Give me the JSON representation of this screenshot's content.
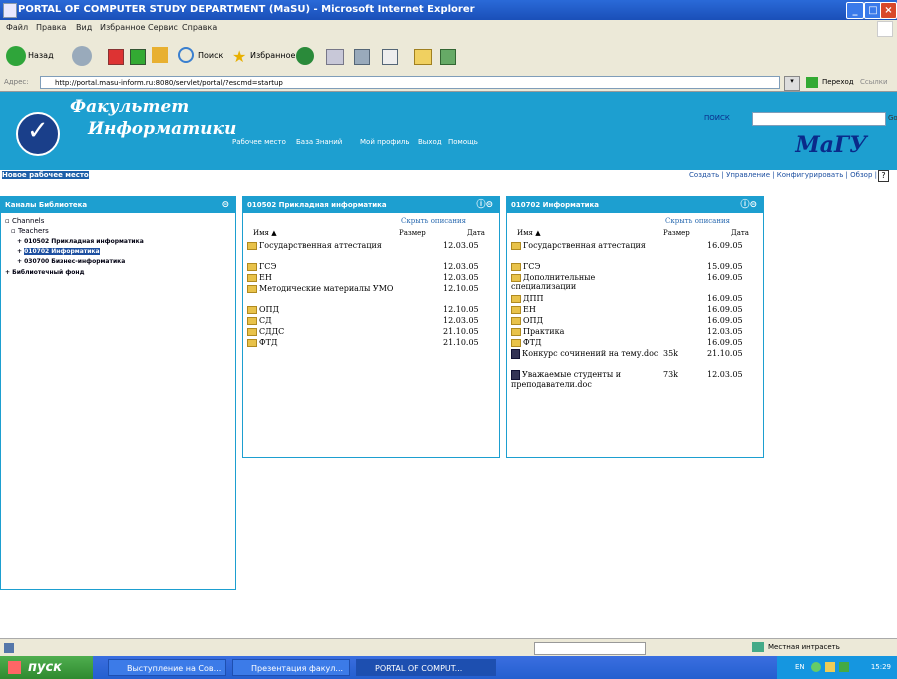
{
  "window": {
    "title": "PORTAL OF COMPUTER STUDY DEPARTMENT (MaSU) - Microsoft Internet Explorer"
  },
  "menu": [
    "Файл",
    "Правка",
    "Вид",
    "Избранное",
    "Сервис",
    "Справка"
  ],
  "toolbar": {
    "back": "Назад",
    "search": "Поиск",
    "favorites": "Избранное"
  },
  "address": {
    "label": "Адрес:",
    "url": "http://portal.masu-inform.ru:8080/servlet/portal/?escmd=startup",
    "go": "Переход",
    "links": "Ссылки"
  },
  "portal": {
    "logo_line1": "Факультет",
    "logo_line2": "Информатики",
    "brand": "МаГУ",
    "search_label": "ПОИСК",
    "search_go": "Go",
    "nav": [
      "Рабочее место",
      "База Знаний",
      "Мой профиль",
      "Выход",
      "Помощь"
    ],
    "subbar_left": "Новое рабочее место",
    "subbar_right": "Создать | Управление | Конфигурировать | Обзор |"
  },
  "panels": {
    "channels": {
      "title": "Каналы  Библиотека",
      "tree": [
        "Channels",
        "Teachers",
        "010502 Прикладная информатика",
        "010702 Информатика",
        "030700 Бизнес-информатика",
        "Библиотечный фонд"
      ]
    },
    "p1": {
      "title": "010502 Прикладная информатика",
      "hide_link": "Скрыть описания",
      "col_name": "Имя ▲",
      "col_size": "Размер",
      "col_date": "Дата",
      "rows": [
        {
          "name": "Государственная аттестация",
          "size": "",
          "date": "12.03.05",
          "type": "folder"
        },
        {
          "name": "ГСЭ",
          "size": "",
          "date": "12.03.05",
          "type": "folder"
        },
        {
          "name": "ЕН",
          "size": "",
          "date": "12.03.05",
          "type": "folder"
        },
        {
          "name": "Методические материалы УМО",
          "size": "",
          "date": "12.10.05",
          "type": "folder"
        },
        {
          "name": "ОПД",
          "size": "",
          "date": "12.10.05",
          "type": "folder"
        },
        {
          "name": "СД",
          "size": "",
          "date": "12.03.05",
          "type": "folder"
        },
        {
          "name": "СДДС",
          "size": "",
          "date": "21.10.05",
          "type": "folder"
        },
        {
          "name": "ФТД",
          "size": "",
          "date": "21.10.05",
          "type": "folder"
        }
      ]
    },
    "p2": {
      "title": "010702 Информатика",
      "hide_link": "Скрыть описания",
      "col_name": "Имя ▲",
      "col_size": "Размер",
      "col_date": "Дата",
      "rows": [
        {
          "name": "Государственная аттестация",
          "size": "",
          "date": "16.09.05",
          "type": "folder"
        },
        {
          "name": "ГСЭ",
          "size": "",
          "date": "15.09.05",
          "type": "folder"
        },
        {
          "name": "Дополнительные специализации",
          "size": "",
          "date": "16.09.05",
          "type": "folder"
        },
        {
          "name": "ДПП",
          "size": "",
          "date": "16.09.05",
          "type": "folder"
        },
        {
          "name": "ЕН",
          "size": "",
          "date": "16.09.05",
          "type": "folder"
        },
        {
          "name": "ОПД",
          "size": "",
          "date": "16.09.05",
          "type": "folder"
        },
        {
          "name": "Практика",
          "size": "",
          "date": "12.03.05",
          "type": "folder"
        },
        {
          "name": "ФТД",
          "size": "",
          "date": "16.09.05",
          "type": "folder"
        },
        {
          "name": "Конкурс сочинений на тему.doc",
          "size": "35k",
          "date": "21.10.05",
          "type": "doc"
        },
        {
          "name": "Уважаемые студенты и преподаватели.doc",
          "size": "73k",
          "date": "12.03.05",
          "type": "doc"
        }
      ]
    }
  },
  "status": {
    "zone": "Местная интрасеть"
  },
  "taskbar": {
    "start": "пуск",
    "tasks": [
      "Выступление на Сов...",
      "Презентация факул...",
      "PORTAL OF COMPUT..."
    ],
    "lang": "EN",
    "clock": "15:29"
  }
}
